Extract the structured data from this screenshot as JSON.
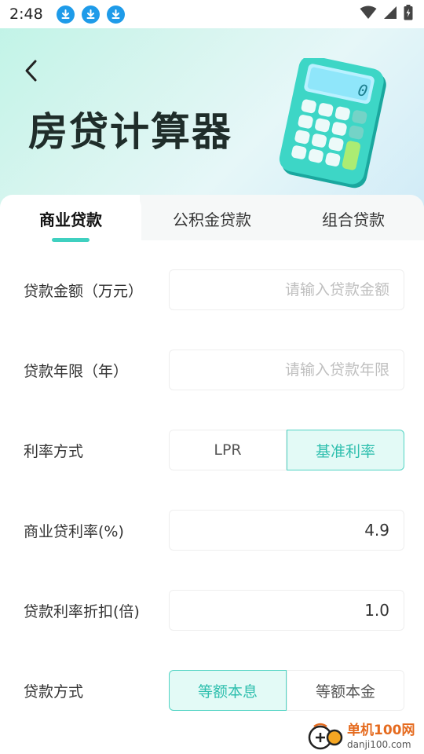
{
  "status_bar": {
    "time": "2:48",
    "download_icons": [
      "download-icon",
      "download-icon",
      "download-icon"
    ],
    "right_icons": [
      "wifi-icon",
      "cellular-signal-icon",
      "battery-charging-icon"
    ]
  },
  "header": {
    "title": "房贷计算器"
  },
  "tabs": [
    {
      "label": "商业贷款",
      "active": true
    },
    {
      "label": "公积金贷款",
      "active": false
    },
    {
      "label": "组合贷款",
      "active": false
    }
  ],
  "form": {
    "loan_amount": {
      "label": "贷款金额（万元）",
      "value": "",
      "placeholder": "请输入贷款金额"
    },
    "loan_years": {
      "label": "贷款年限（年）",
      "value": "",
      "placeholder": "请输入贷款年限"
    },
    "rate_mode": {
      "label": "利率方式",
      "options": [
        "LPR",
        "基准利率"
      ],
      "selected": "基准利率"
    },
    "commercial_rate": {
      "label": "商业贷利率(%)",
      "value": "4.9"
    },
    "rate_discount": {
      "label": "贷款利率折扣(倍)",
      "value": "1.0"
    },
    "repay_method": {
      "label": "贷款方式",
      "options": [
        "等额本息",
        "等额本金"
      ],
      "selected": "等额本息"
    }
  },
  "watermark": {
    "cn": "单机100网",
    "en": "danji100.com"
  },
  "colors": {
    "accent": "#3fd0c0",
    "selected_bg": "#e3faf6",
    "selected_text": "#2fbfae"
  }
}
